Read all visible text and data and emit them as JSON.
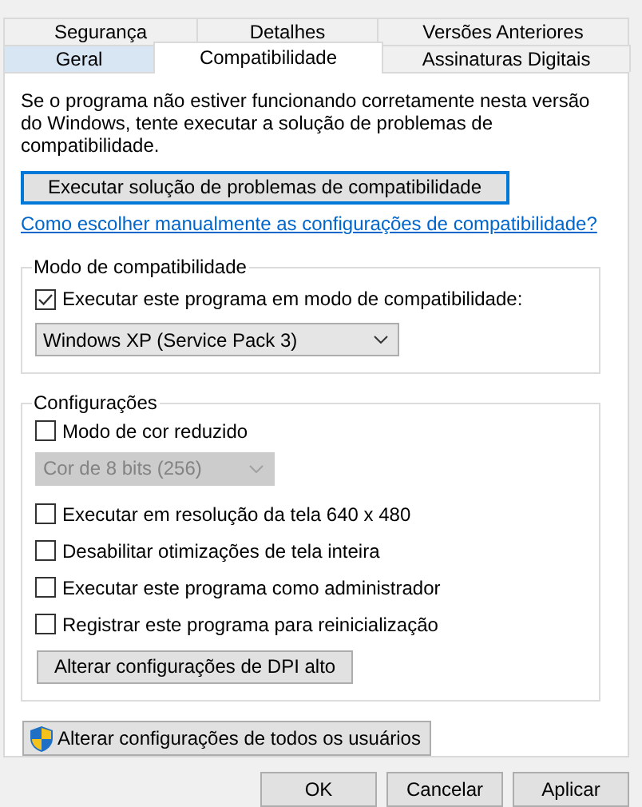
{
  "tab_rows": [
    [
      {
        "label": "Segurança",
        "selected": false,
        "hovered": false
      },
      {
        "label": "Detalhes",
        "selected": false,
        "hovered": false
      },
      {
        "label": "Versões Anteriores",
        "selected": false,
        "hovered": false
      }
    ],
    [
      {
        "label": "Geral",
        "selected": false,
        "hovered": true
      },
      {
        "label": "Compatibilidade",
        "selected": true,
        "hovered": false
      },
      {
        "label": "Assinaturas Digitais",
        "selected": false,
        "hovered": false
      }
    ]
  ],
  "description": "Se o programa não estiver funcionando corretamente nesta versão do Windows, tente executar a solução de problemas de compatibilidade.",
  "troubleshoot_button": {
    "label": "Executar solução de problemas de compatibilidade",
    "focused": true
  },
  "help_link": "Como escolher manualmente as configurações de compatibilidade?",
  "compat_group": {
    "title": "Modo de compatibilidade",
    "checkbox": {
      "label": "Executar este programa em modo de compatibilidade:",
      "checked": true
    },
    "select": {
      "value": "Windows XP (Service Pack 3)",
      "disabled": false
    }
  },
  "settings_group": {
    "title": "Configurações",
    "items": [
      {
        "kind": "checkbox",
        "label": "Modo de cor reduzido",
        "checked": false
      },
      {
        "kind": "select",
        "value": "Cor de 8 bits (256)",
        "disabled": true
      },
      {
        "kind": "checkbox",
        "label": "Executar em resolução da tela 640 x 480",
        "checked": false
      },
      {
        "kind": "checkbox",
        "label": "Desabilitar otimizações de tela inteira",
        "checked": false
      },
      {
        "kind": "checkbox",
        "label": "Executar este programa como administrador",
        "checked": false
      },
      {
        "kind": "checkbox",
        "label": "Registrar este programa para reinicialização",
        "checked": false
      },
      {
        "kind": "button",
        "label": "Alterar configurações de DPI alto"
      }
    ]
  },
  "all_users_button": {
    "label": "Alterar configurações de todos os usuários"
  },
  "buttons": [
    "OK",
    "Cancelar",
    "Aplicar"
  ]
}
